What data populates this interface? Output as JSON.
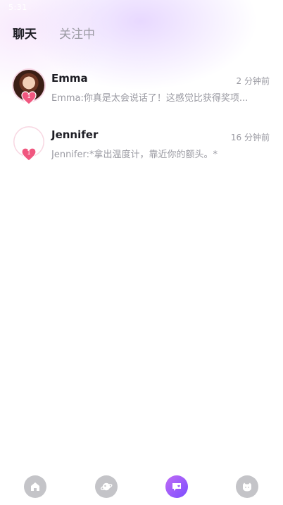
{
  "status_bar": {
    "time": "5:31"
  },
  "tabs": [
    {
      "label": "聊天",
      "active": true
    },
    {
      "label": "关注中",
      "active": false
    }
  ],
  "chats": [
    {
      "name": "Emma",
      "time": "2 分钟前",
      "preview": "Emma:你真是太会说话了！这感觉比获得奖项...",
      "heart_count": "1"
    },
    {
      "name": "Jennifer",
      "time": "16 分钟前",
      "preview": "Jennifer:*拿出温度计，靠近你的额头。*",
      "heart_count": "1"
    }
  ],
  "bottom_nav": {
    "items": [
      {
        "icon": "home-icon",
        "active": false
      },
      {
        "icon": "planet-icon",
        "active": false
      },
      {
        "icon": "chat-icon",
        "active": true
      },
      {
        "icon": "profile-face-icon",
        "active": false
      }
    ]
  },
  "colors": {
    "accent": "#9a5cf7",
    "heart": "#f0577f",
    "muted_text": "#9a9aa2"
  }
}
